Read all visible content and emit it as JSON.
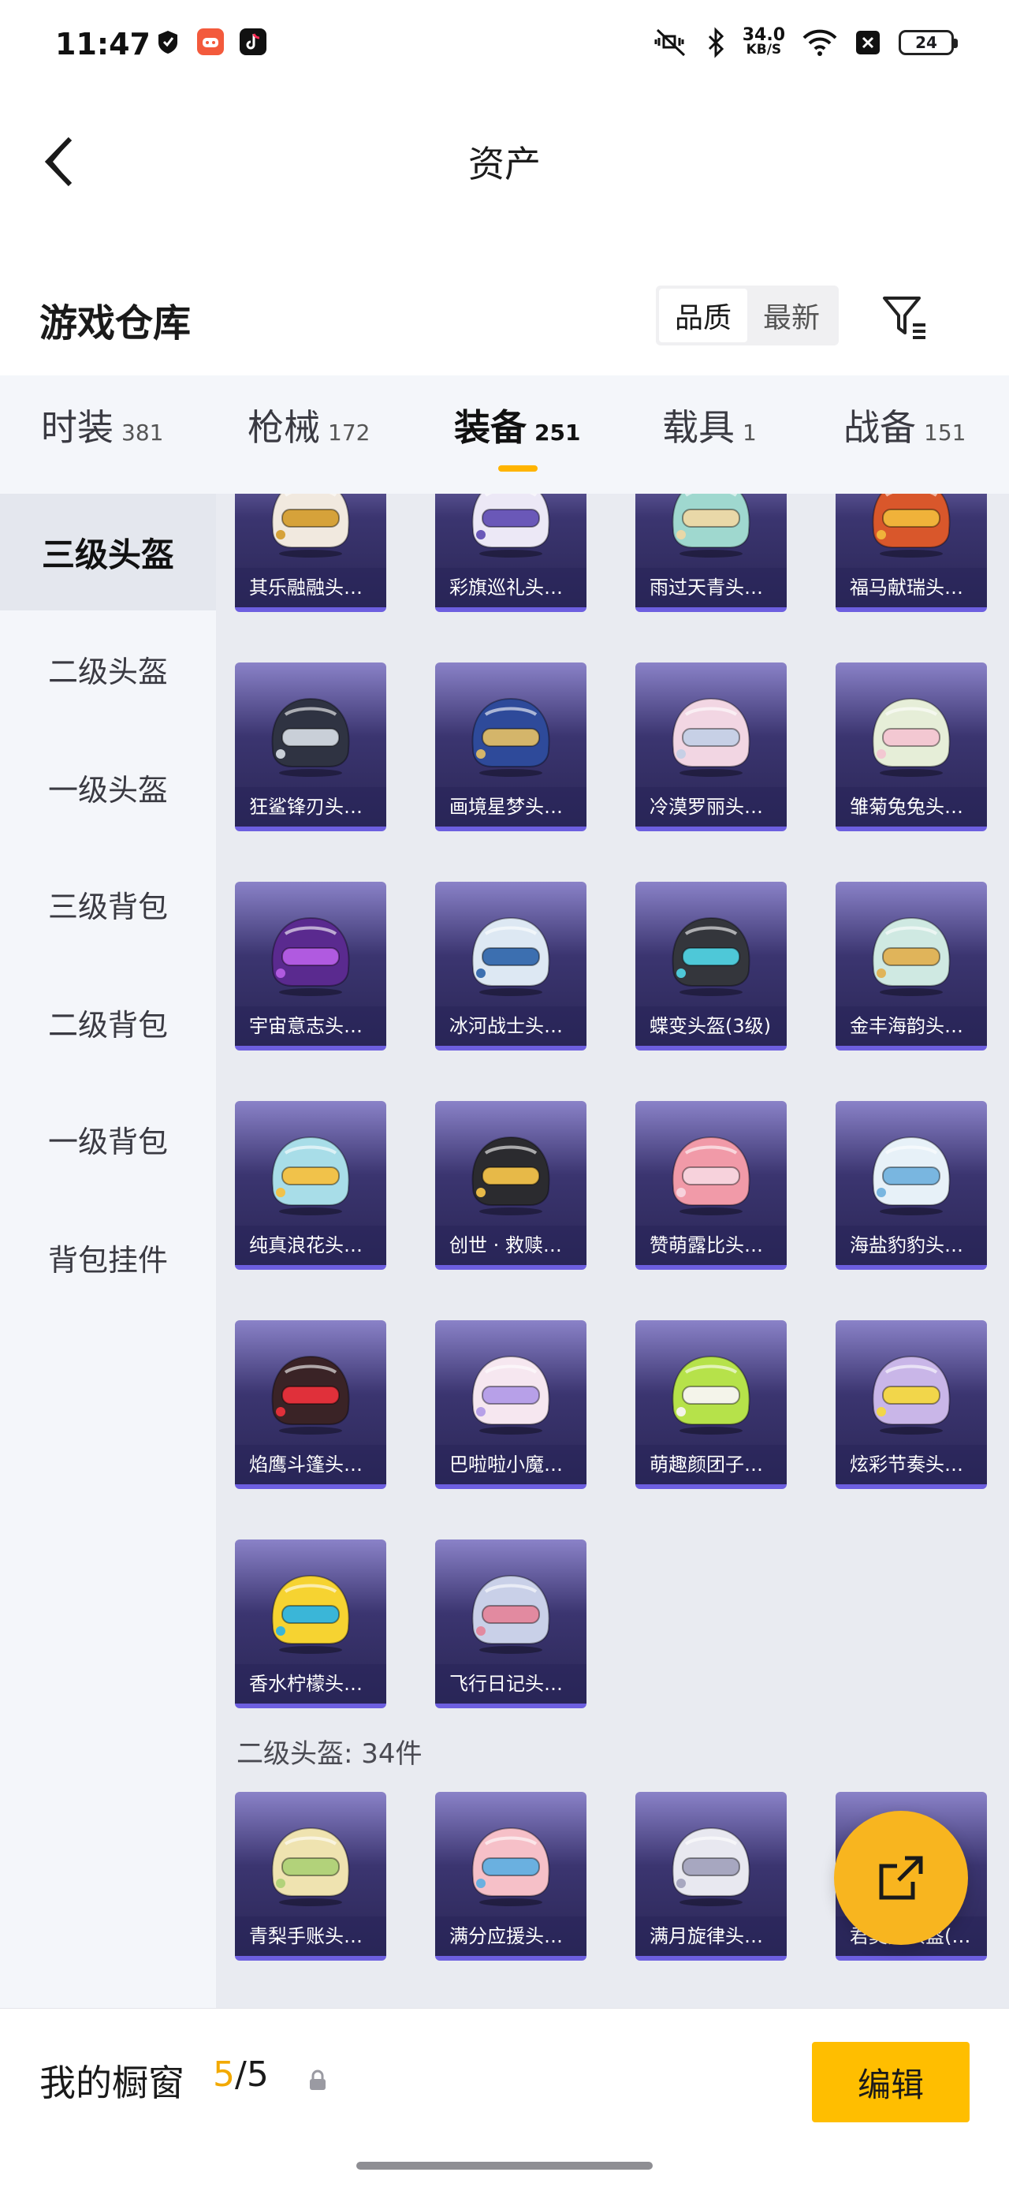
{
  "status_bar": {
    "time": "11:47",
    "net_speed_value": "34.0",
    "net_speed_unit": "KB/S",
    "battery": "24",
    "icons": [
      "shield-app-icon",
      "game-app-icon",
      "tiktok-icon",
      "mute-vibrate-icon",
      "bluetooth-icon",
      "wifi-icon",
      "close-box-icon"
    ]
  },
  "header": {
    "title": "资产"
  },
  "warehouse": {
    "title": "游戏仓库",
    "sort_options": [
      "品质",
      "最新"
    ],
    "active_sort": "品质"
  },
  "tabs": [
    {
      "label": "时装",
      "count": "381"
    },
    {
      "label": "枪械",
      "count": "172"
    },
    {
      "label": "装备",
      "count": "251",
      "active": true
    },
    {
      "label": "载具",
      "count": "1"
    },
    {
      "label": "战备",
      "count": "151"
    }
  ],
  "sidebar": {
    "items": [
      "三级头盔",
      "二级头盔",
      "一级头盔",
      "三级背包",
      "二级背包",
      "一级背包",
      "背包挂件"
    ],
    "active": "三级头盔"
  },
  "grid": {
    "level3_items": [
      {
        "name": "其乐融融头…",
        "color": "#f1e9df",
        "accent": "#d6a23a"
      },
      {
        "name": "彩旗巡礼头…",
        "color": "#ece8f6",
        "accent": "#6a58b8"
      },
      {
        "name": "雨过天青头…",
        "color": "#9fd8cf",
        "accent": "#e9d8a8"
      },
      {
        "name": "福马献瑞头…",
        "color": "#d9572b",
        "accent": "#f0b23a"
      },
      {
        "name": "狂鲨锋刃头…",
        "color": "#2f3342",
        "accent": "#c9cfd8"
      },
      {
        "name": "画境星梦头…",
        "color": "#2e4a9a",
        "accent": "#d4b56a"
      },
      {
        "name": "冷漠罗丽头…",
        "color": "#f2d6e3",
        "accent": "#c7d0e6"
      },
      {
        "name": "雏菊兔兔头…",
        "color": "#e6eed8",
        "accent": "#f3c8d2"
      },
      {
        "name": "宇宙意志头…",
        "color": "#5a2a8f",
        "accent": "#b05ae0"
      },
      {
        "name": "冰河战士头…",
        "color": "#dde8f3",
        "accent": "#3c6fb0"
      },
      {
        "name": "蝶变头盔(3级)",
        "color": "#34363c",
        "accent": "#4ec8d8"
      },
      {
        "name": "金丰海韵头…",
        "color": "#cfe9e2",
        "accent": "#e0b45a"
      },
      {
        "name": "纯真浪花头…",
        "color": "#a8dde8",
        "accent": "#f1c24a"
      },
      {
        "name": "创世 · 救赎…",
        "color": "#2b2b2f",
        "accent": "#e7b948"
      },
      {
        "name": "赞萌露比头…",
        "color": "#f19aa8",
        "accent": "#f7d2dc"
      },
      {
        "name": "海盐豹豹头…",
        "color": "#e7f1f8",
        "accent": "#79b6e0"
      },
      {
        "name": "焰鹰斗篷头…",
        "color": "#3a2326",
        "accent": "#e0303a"
      },
      {
        "name": "巴啦啦小魔…",
        "color": "#f6e7f0",
        "accent": "#b7a0e8"
      },
      {
        "name": "萌趣颜团子…",
        "color": "#b6e24a",
        "accent": "#f4f4ea"
      },
      {
        "name": "炫彩节奏头…",
        "color": "#c9b6e8",
        "accent": "#f2d64a"
      },
      {
        "name": "香水柠檬头…",
        "color": "#f6d331",
        "accent": "#3ab6d8"
      },
      {
        "name": "飞行日记头…",
        "color": "#c9d0e8",
        "accent": "#e28aa0"
      }
    ],
    "section_label": "二级头盔: 34件",
    "level2_items": [
      {
        "name": "青梨手账头…",
        "color": "#efe3b0",
        "accent": "#b2d27a"
      },
      {
        "name": "满分应援头…",
        "color": "#f6c0c8",
        "accent": "#6ab0e0"
      },
      {
        "name": "满月旋律头…",
        "color": "#e8e8f0",
        "accent": "#a7a7c0"
      },
      {
        "name": "君莫笑头盔(…",
        "color": "#d8d0c0",
        "accent": "#8a7a5a"
      }
    ]
  },
  "bottom_bar": {
    "label": "我的橱窗",
    "current": "5",
    "separator": "/",
    "total": "5",
    "edit_label": "编辑"
  },
  "colors": {
    "accent": "#FFBE00",
    "tab_indicator": "#FFB400",
    "card_gradient_top": "#8A82C8",
    "card_gradient_bottom": "#2B2756"
  }
}
